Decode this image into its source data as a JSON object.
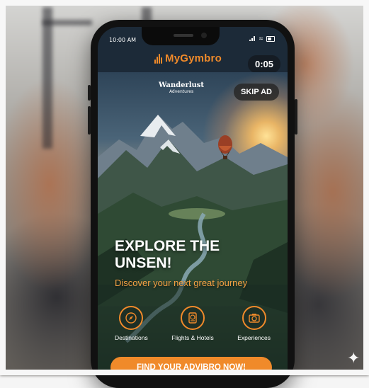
{
  "statusbar": {
    "time": "10:00 AM"
  },
  "app": {
    "name": "MyGymbro",
    "timer": "0:05"
  },
  "ad": {
    "brand_name": "Wanderlust",
    "brand_sub": "Adventures",
    "skip_label": "SKIP AD",
    "headline_line1": "EXPLORE THE",
    "headline_line2": "UNSEN!",
    "subheadline": "Discover your next great journey",
    "features": [
      {
        "label": "Destinations",
        "icon": "compass-icon"
      },
      {
        "label": "Flights & Hotels",
        "icon": "passport-icon"
      },
      {
        "label": "Experiences",
        "icon": "camera-icon"
      }
    ],
    "cta_label": "FIND YOUR ADVIBRO NOW!"
  },
  "colors": {
    "accent": "#f08a2a",
    "timer_bg": "#151c24",
    "phone": "#111111"
  },
  "watermark": {
    "icon": "sparkle-icon"
  }
}
